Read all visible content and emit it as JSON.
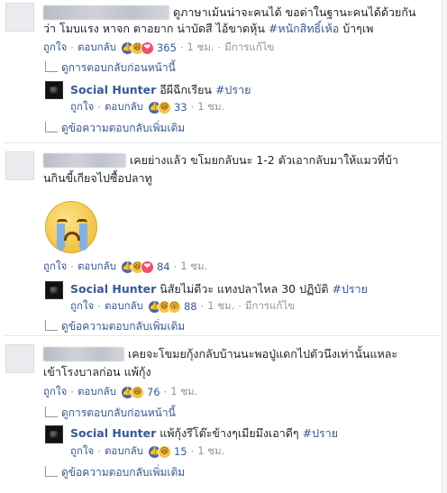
{
  "comments": [
    {
      "text_line1": "ดูภาษาเม้นน่าจะคนได้ ขอด่าในฐานะคนได้ด้วยกัน",
      "text_line2_plain": "ว่า โมบแรง หาจก ตาอยาก น่าบัดสี ไอ้ขาดหุ้น ",
      "text_line2_tag": "#หนักสิทธิ์เห้อ",
      "text_line2_end": " บ้าๆเพ",
      "like_label": "ถูกใจ",
      "reply_label": "ตอบกลับ",
      "reaction_count": "365",
      "time": "1 ชม.",
      "edited": "มีการแก้ไข",
      "prev_replies": "ดูการตอบกลับก่อนหน้านี้",
      "reply": {
        "author": "Social Hunter",
        "text_plain": " อีผีฉีกเรียน ",
        "text_tag": "#ปราย",
        "like_label": "ถูกใจ",
        "reply_label": "ตอบกลับ",
        "reaction_count": "33",
        "time": "1 ชม."
      },
      "more_replies": "ดูข้อความตอบกลับเพิ่มเติม"
    },
    {
      "text_line1": "เคยย่างแล้ว ขโมยกลับนะ 1-2 ตัวเอากลับมาให้แมวที่บ้า",
      "text_line2": "นกินขี้เกียจไปซื้อปลาทู",
      "like_label": "ถูกใจ",
      "reply_label": "ตอบกลับ",
      "reaction_count": "84",
      "time": "1 ชม.",
      "reply": {
        "author": "Social Hunter",
        "text_plain": " นิสัยไม่ดีวะ แทงปลาไหล 30 ปฏิบัติ ",
        "text_tag": "#ปราย",
        "like_label": "ถูกใจ",
        "reply_label": "ตอบกลับ",
        "reaction_count": "88",
        "time": "1 ชม.",
        "edited": "มีการแก้ไข"
      },
      "more_replies": "ดูข้อความตอบกลับเพิ่มเติม"
    },
    {
      "text_line1": "เคยจะโขมยกุ้งกลับบ้านนะพอปู่แดกไปตัวนึงเท่านั้นแหละ",
      "text_line2": "เข้าโรงบาลก่อน แพ้กุ้ง",
      "like_label": "ถูกใจ",
      "reply_label": "ตอบกลับ",
      "reaction_count": "76",
      "time": "1 ชม.",
      "prev_replies": "ดูการตอบกลับก่อนหน้านี้",
      "reply": {
        "author": "Social Hunter",
        "text_plain": " แพ้กุ้งรึโต๊ะข้างๆเมียมึงเอาดีๆ ",
        "text_tag": "#ปราย",
        "like_label": "ถูกใจ",
        "reply_label": "ตอบกลับ",
        "reaction_count": "15",
        "time": "1 ชม."
      },
      "more_replies": "ดูข้อความตอบกลับเพิ่มเติม"
    }
  ],
  "separator": "·",
  "icons": {
    "like": "like-reaction-icon",
    "haha": "haha-reaction-icon",
    "love": "love-reaction-icon",
    "wow": "wow-reaction-icon",
    "reply_arrow": "reply-arrow-icon",
    "crying_emoji": "crying-emoji-sticker"
  },
  "colors": {
    "link": "#365899",
    "text": "#1d2129",
    "meta": "#90949c",
    "like": "#4267b2"
  }
}
